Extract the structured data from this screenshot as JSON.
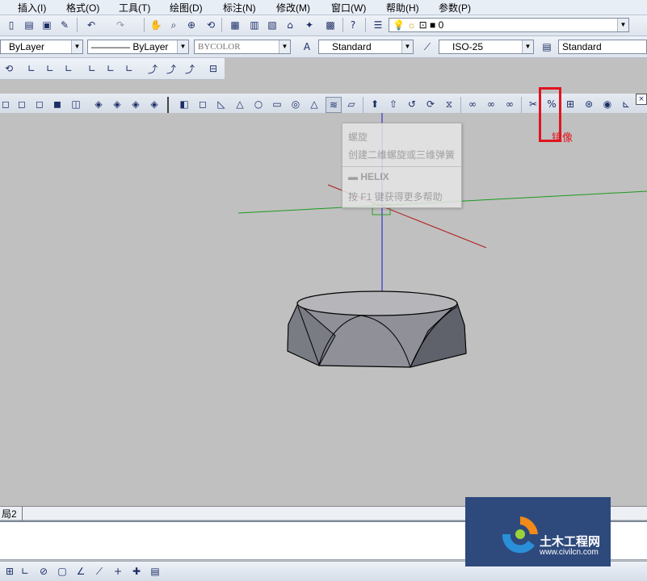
{
  "menu": [
    "插入(I)",
    "格式(O)",
    "工具(T)",
    "绘图(D)",
    "标注(N)",
    "修改(M)",
    "窗口(W)",
    "帮助(H)",
    "参数(P)"
  ],
  "standard_toolbar": {
    "layer_value": "0"
  },
  "properties": {
    "color": "ByLayer",
    "linetype": "ByLayer",
    "lineweight": "BYCOLOR",
    "text_style": "Standard",
    "dim_style": "ISO-25",
    "table_style": "Standard"
  },
  "annotation": {
    "mirror_label": "镜像",
    "highlight_color": "#e0141e"
  },
  "tooltip": {
    "title": "螺旋",
    "description": "创建二维螺旋或三维弹簧",
    "command": "HELIX",
    "help": "按 F1 键获得更多帮助"
  },
  "layout_tab": "局2",
  "watermark": {
    "site": "土木工程网",
    "url": "www.civilcn.com"
  },
  "icons": [
    "new-icon",
    "open-icon",
    "save-icon",
    "undo-icon",
    "redo-icon",
    "pan-icon",
    "zoom-icon",
    "layer-icon",
    "text-style-icon",
    "dim-style-icon",
    "table-style-icon",
    "helix-icon",
    "mirror3d-icon",
    "box-icon",
    "sphere-icon",
    "cylinder-icon",
    "cone-icon",
    "torus-icon",
    "pyramid-icon",
    "wedge-icon",
    "union-icon",
    "subtract-icon",
    "intersect-icon"
  ],
  "colors": {
    "x_axis": "#b01818",
    "y_axis": "#1a9a1a",
    "z_axis": "#1a1ad0",
    "solid": "#8f9098"
  }
}
